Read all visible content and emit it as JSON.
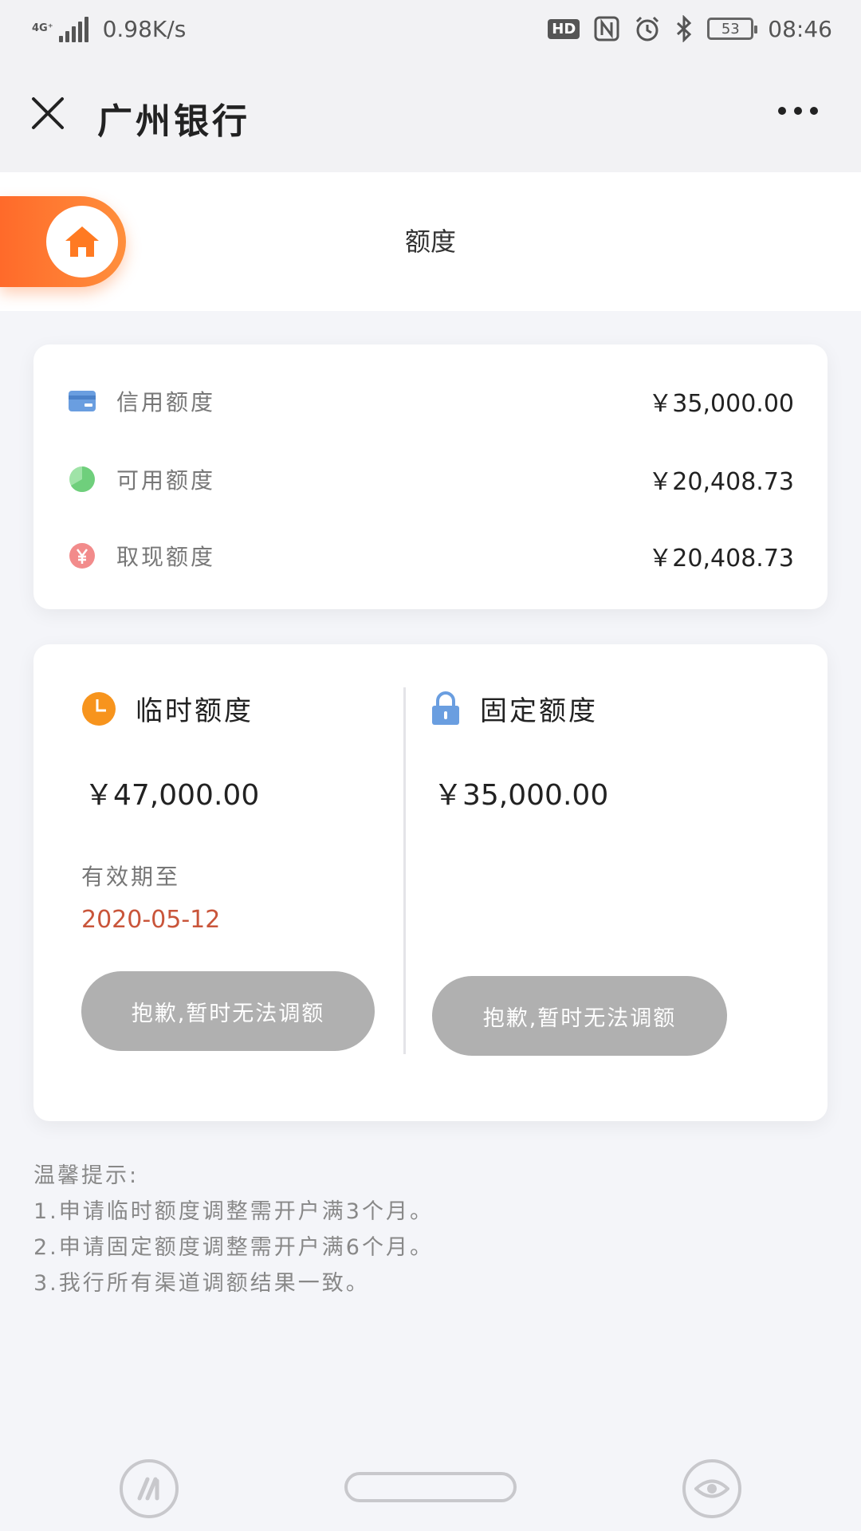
{
  "status_bar": {
    "network_type": "4G⁺",
    "speed": "0.98K/s",
    "hd_badge": "HD",
    "battery_level": "53",
    "time": "08:46"
  },
  "nav": {
    "title": "广州银行"
  },
  "header": {
    "page_title": "额度"
  },
  "limits": [
    {
      "label": "信用额度",
      "value": "￥35,000.00",
      "icon": "credit-card-icon",
      "color": "#6a9ee0"
    },
    {
      "label": "可用额度",
      "value": "￥20,408.73",
      "icon": "pie-icon",
      "color": "#7fd68a"
    },
    {
      "label": "取现额度",
      "value": "￥20,408.73",
      "icon": "yuan-icon",
      "color": "#f28b8b"
    }
  ],
  "temporary": {
    "title": "临时额度",
    "amount": "￥47,000.00",
    "valid_label": "有效期至",
    "valid_date": "2020-05-12",
    "button": "抱歉,暂时无法调额"
  },
  "fixed": {
    "title": "固定额度",
    "amount": "￥35,000.00",
    "button": "抱歉,暂时无法调额"
  },
  "tips": {
    "heading": "温馨提示:",
    "items": [
      "1.申请临时额度调整需开户满3个月。",
      "2.申请固定额度调整需开户满6个月。",
      "3.我行所有渠道调额结果一致。"
    ]
  },
  "colors": {
    "accent_orange": "#ff7a33",
    "date_red": "#c9553a",
    "button_gray": "#b0b0b0"
  }
}
